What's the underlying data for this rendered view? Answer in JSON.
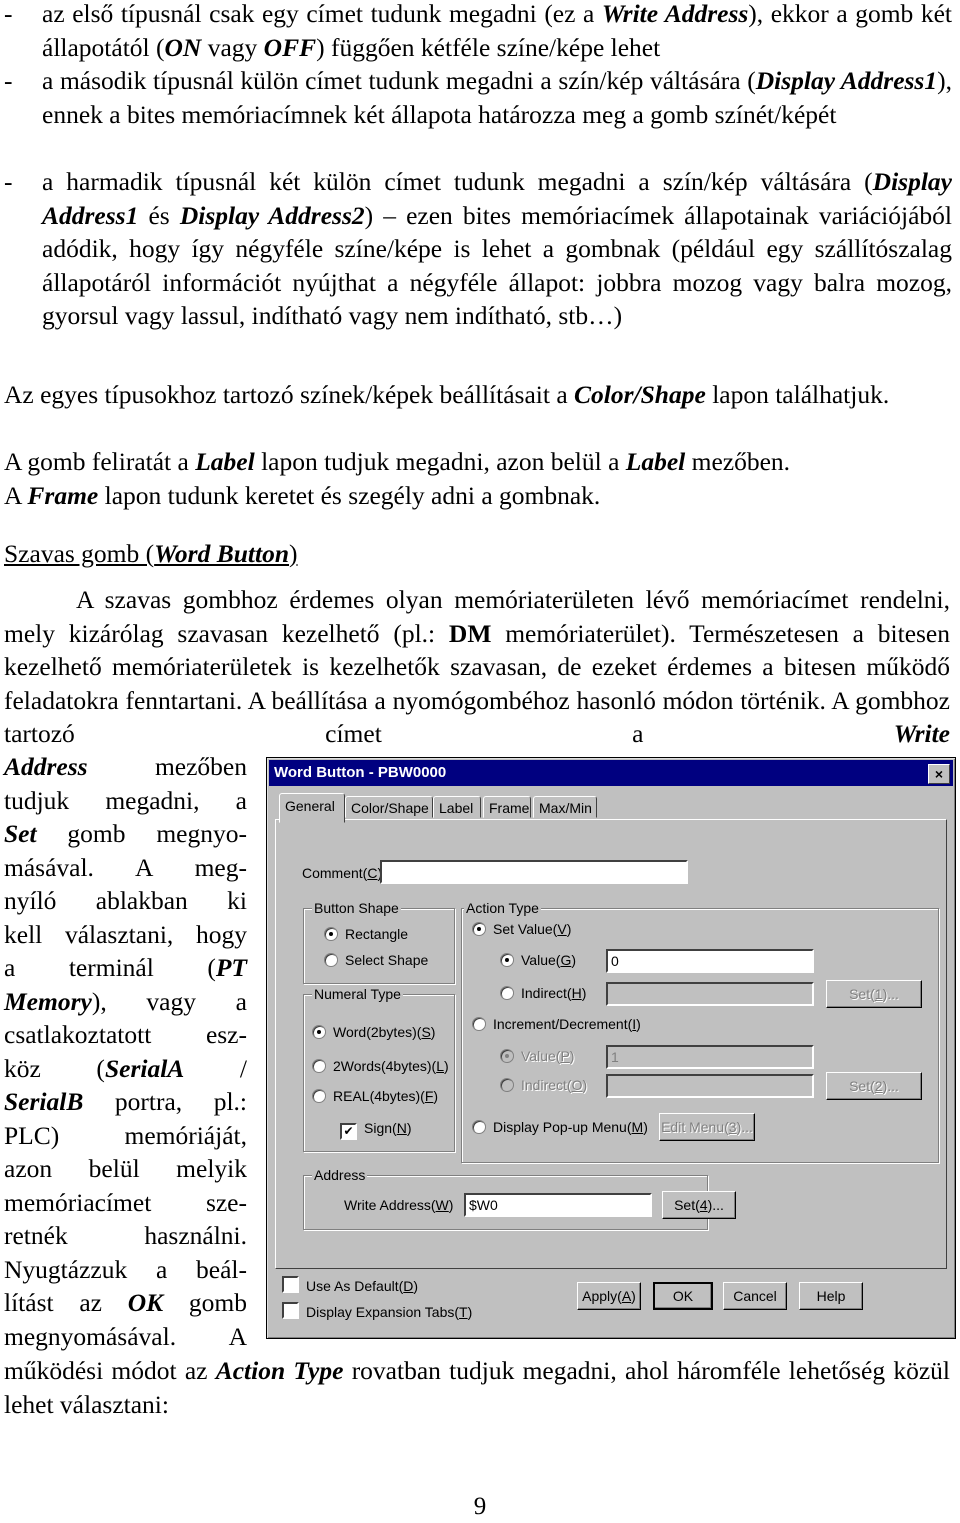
{
  "bullets": [
    {
      "dash": "-",
      "parts": [
        {
          "t": "az első típusnál csak egy címet tudunk megadni (ez a "
        },
        {
          "t": "Write Address",
          "bi": true
        },
        {
          "t": "), ekkor a gomb két állapotától ("
        },
        {
          "t": "ON",
          "bi": true
        },
        {
          "t": " vagy "
        },
        {
          "t": "OFF",
          "bi": true
        },
        {
          "t": ") függően kétféle színe/képe lehet"
        }
      ]
    },
    {
      "dash": "-",
      "parts": [
        {
          "t": "a második típusnál külön címet tudunk megadni a szín/kép váltására ("
        },
        {
          "t": "Display Address1",
          "bi": true
        },
        {
          "t": "), ennek a bites memóriacímnek két állapota határozza meg a gomb színét/képét"
        }
      ]
    },
    {
      "dash": "-",
      "parts": [
        {
          "t": "a harmadik típusnál két külön címet tudunk megadni a szín/kép váltására ("
        },
        {
          "t": "Display Address1",
          "bi": true
        },
        {
          "t": " és "
        },
        {
          "t": "Display Address2",
          "bi": true
        },
        {
          "t": ") – ezen bites memóriacímek állapotainak variációjából adódik, hogy így négyféle színe/képe is lehet a gombnak (például egy szállítószalag állapotáról információt nyújthat a négyféle állapot: jobbra mozog vagy balra mozog, gyorsul vagy lassul, indítható vagy nem indítható, stb…)"
        }
      ]
    }
  ],
  "paragraphs": {
    "color_shape": [
      {
        "t": "Az egyes típusokhoz tartozó színek/képek beállításait a "
      },
      {
        "t": "Color/Shape",
        "bi": true
      },
      {
        "t": " lapon találhatjuk."
      }
    ],
    "label": [
      {
        "t": "A gomb feliratát a "
      },
      {
        "t": "Label",
        "bi": true
      },
      {
        "t": " lapon tudjuk megadni, azon belül a "
      },
      {
        "t": "Label",
        "bi": true
      },
      {
        "t": " mezőben."
      }
    ],
    "frame": [
      {
        "t": "A "
      },
      {
        "t": "Frame",
        "bi": true
      },
      {
        "t": " lapon tudunk keretet és szegély adni a gombnak."
      }
    ],
    "heading": [
      {
        "t": "Szavas gomb ("
      },
      {
        "t": "Word Button",
        "bi": true
      },
      {
        "t": ")"
      }
    ],
    "intro": [
      {
        "t": "A szavas gombhoz érdemes olyan memóriaterületen lévő memóriacímet rendelni, mely kizárólag szavasan kezelhető (pl.: "
      },
      {
        "t": "DM",
        "b": true
      },
      {
        "t": " memóriaterület). Természetesen a bitesen kezelhető memóriaterületek is kezelhetők szavasan, de ezeket érdemes a bitesen működő feladatokra fenntartani. A beállítása a nyomógombéhoz hasonló módon történik. A gombhoz tartozó címet a "
      },
      {
        "t": "Write",
        "bi": true
      }
    ],
    "side_lines": [
      [
        {
          "t": "Address",
          "bi": true
        },
        {
          "t": " mezőben"
        }
      ],
      [
        {
          "t": "tudjuk megadni, a"
        }
      ],
      [
        {
          "t": "Set",
          "bi": true
        },
        {
          "t": " gomb megnyo-"
        }
      ],
      [
        {
          "t": "másával. A meg-"
        }
      ],
      [
        {
          "t": "nyíló ablakban ki"
        }
      ],
      [
        {
          "t": "kell választani, hogy"
        }
      ],
      [
        {
          "t": "a terminál ("
        },
        {
          "t": "PT",
          "bi": true
        }
      ],
      [
        {
          "t": "Memory",
          "bi": true
        },
        {
          "t": "), vagy a"
        }
      ],
      [
        {
          "t": "csatlakoztatott esz-"
        }
      ],
      [
        {
          "t": "köz ("
        },
        {
          "t": "SerialA",
          "bi": true
        },
        {
          "t": " /"
        }
      ],
      [
        {
          "t": "SerialB",
          "bi": true
        },
        {
          "t": " portra, pl.:"
        }
      ],
      [
        {
          "t": "PLC) memóriáját,"
        }
      ],
      [
        {
          "t": "azon belül melyik"
        }
      ],
      [
        {
          "t": "memóriacímet sze-"
        }
      ],
      [
        {
          "t": "retnék használni."
        }
      ],
      [
        {
          "t": "Nyugtázzuk a beál-"
        }
      ],
      [
        {
          "t": "lítást az "
        },
        {
          "t": "OK",
          "bi": true
        },
        {
          "t": " gomb"
        }
      ],
      [
        {
          "t": "megnyomásával. A"
        }
      ]
    ],
    "final": [
      {
        "t": "működési módot az "
      },
      {
        "t": "Action Type",
        "bi": true
      },
      {
        "t": " rovatban tudjuk megadni, ahol háromféle lehetőség közül lehet választani:"
      }
    ]
  },
  "dialog": {
    "title": "Word Button - PBW0000",
    "close_icon": "×",
    "tabs": [
      "General",
      "Color/Shape",
      "Label",
      "Frame",
      "Max/Min"
    ],
    "active_tab": "General",
    "comment_label": "Comment(",
    "comment_key": "C",
    "comment_value": "",
    "button_shape": {
      "legend": "Button Shape",
      "options": [
        {
          "label": "Rectangle",
          "selected": true
        },
        {
          "label": "Select Shape",
          "selected": false
        }
      ]
    },
    "numeral_type": {
      "legend": "Numeral Type",
      "options": [
        {
          "label": "Word(2bytes)(",
          "key": "S",
          "selected": true
        },
        {
          "label": "2Words(4bytes)(",
          "key": "L",
          "selected": false
        },
        {
          "label": "REAL(4bytes)(",
          "key": "F",
          "selected": false
        }
      ],
      "sign_label": "Sign(",
      "sign_key": "N",
      "sign_checked": true,
      "check_glyph": "✔"
    },
    "action_type": {
      "legend": "Action Type",
      "set_value": {
        "label": "Set Value(",
        "key": "V",
        "selected": true
      },
      "value_g": {
        "label": "Value(",
        "key": "G",
        "selected": true,
        "input": "0"
      },
      "indirect_h": {
        "label": "Indirect(",
        "key": "H",
        "selected": false,
        "input": ""
      },
      "set1": {
        "label": "Set(",
        "key": "1",
        "suffix": ")..."
      },
      "incdec": {
        "label": "Increment/Decrement(",
        "key": "I",
        "selected": false
      },
      "value_p": {
        "label": "Value(",
        "key": "P",
        "selected": true,
        "input": "1"
      },
      "indirect_o": {
        "label": "Indirect(",
        "key": "O",
        "selected": false,
        "input": ""
      },
      "set2": {
        "label": "Set(",
        "key": "2",
        "suffix": ")..."
      },
      "popup": {
        "label": "Display Pop-up Menu(",
        "key": "M",
        "selected": false
      },
      "edit_menu": {
        "label": "Edit Menu(",
        "key": "3",
        "suffix": ")..."
      }
    },
    "address": {
      "legend": "Address",
      "write_label": "Write Address(",
      "write_key": "W",
      "write_value": "$W0",
      "set4": {
        "label": "Set(",
        "key": "4",
        "suffix": ")..."
      }
    },
    "use_default": {
      "label": "Use As Default(",
      "key": "D",
      "checked": false
    },
    "expansion_tabs": {
      "label": "Display Expansion Tabs(",
      "key": "T",
      "checked": false
    },
    "buttons": {
      "apply": {
        "label": "Apply(",
        "key": "A"
      },
      "ok": "OK",
      "cancel": "Cancel",
      "help": "Help"
    }
  },
  "page_number": "9"
}
